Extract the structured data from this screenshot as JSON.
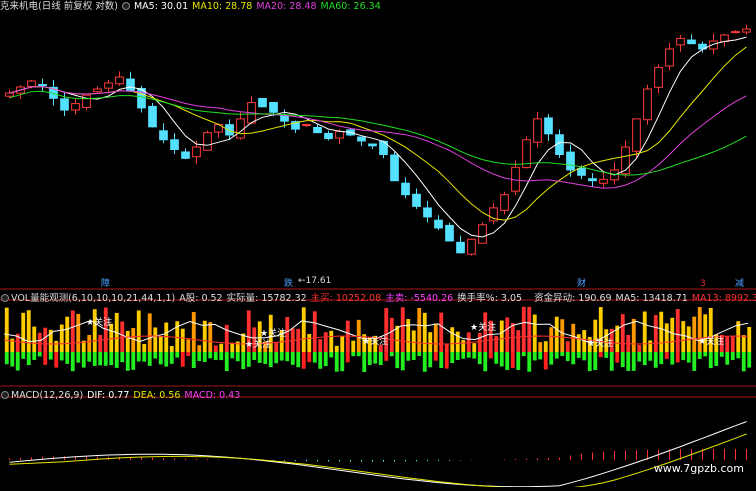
{
  "price_panel": {
    "stock_name": "克来机电(日线 前复权 对数)",
    "ma_labels": [
      {
        "name": "MA5",
        "value": "30.01",
        "color": "#ffffff"
      },
      {
        "name": "MA10",
        "value": "28.78",
        "color": "#e6e600"
      },
      {
        "name": "MA20",
        "value": "28.48",
        "color": "#e040e0"
      },
      {
        "name": "MA60",
        "value": "26.34",
        "color": "#22dd22"
      }
    ],
    "low_price_label": "17.61",
    "event_markers": [
      {
        "text": "障",
        "color": "#4aa0ff"
      },
      {
        "text": "跌",
        "color": "#4aa0ff"
      },
      {
        "text": "财",
        "color": "#4aa0ff"
      },
      {
        "text": "3",
        "color": "#e03030"
      },
      {
        "text": "减",
        "color": "#4aa0ff"
      }
    ]
  },
  "volume_panel": {
    "indicator": "VOL量能观测(6,10,10,10,21,44,1,1)",
    "a_shares": "A股: 0.52",
    "actual": "实际量: 15782.32",
    "main_buy": "主买: 10252.08",
    "main_sell": "主卖: -5540.26",
    "turnover": "换手率%: 3.05",
    "fund_anomaly": "资金异动: 190.69",
    "ma5": "MA5: 13418.71",
    "ma13": "MA13: 8992.33",
    "focus_label": "关注",
    "colors": {
      "text": "#e6e6e6",
      "buy": "#ff3030",
      "sell": "#ff40ff",
      "ma13": "#ff3030",
      "anomaly": "#ffff00"
    }
  },
  "macd_panel": {
    "indicator": "MACD(12,26,9)",
    "dif": "DIF: 0.77",
    "dea": "DEA: 0.56",
    "macd": "MACD: 0.43",
    "colors": {
      "dif": "#ffffff",
      "dea": "#e6e600",
      "macd": "#ff40ff"
    }
  },
  "watermark": "www.7gpzb.com",
  "chart_data": {
    "type": "candlestick",
    "price_series": {
      "note_axis": "log",
      "closes": [
        30.0,
        30.6,
        31.2,
        30.8,
        29.5,
        28.4,
        29.0,
        29.8,
        30.4,
        31.0,
        31.6,
        30.2,
        28.6,
        26.9,
        25.8,
        25.0,
        24.3,
        25.2,
        26.4,
        27.1,
        26.2,
        27.6,
        29.1,
        28.7,
        28.2,
        27.4,
        26.7,
        27.1,
        26.4,
        25.9,
        26.5,
        26.2,
        25.7,
        25.3,
        24.6,
        22.6,
        21.6,
        20.8,
        20.1,
        19.4,
        18.6,
        17.9,
        18.7,
        19.6,
        20.7,
        21.6,
        23.6,
        25.8,
        27.6,
        26.3,
        24.6,
        23.4,
        23.0,
        22.6,
        22.7,
        23.4,
        25.2,
        27.6,
        30.4,
        32.6,
        34.6,
        35.8,
        35.2,
        34.6,
        35.5,
        36.2,
        36.6,
        36.9
      ]
    },
    "ma_series": {
      "MA5": "white",
      "MA10": "yellow",
      "MA20": "magenta",
      "MA60": "green"
    },
    "volume_note": "bars colored yellow/red/green with MA lines",
    "macd_note": "DIF/DEA lines with histogram"
  }
}
